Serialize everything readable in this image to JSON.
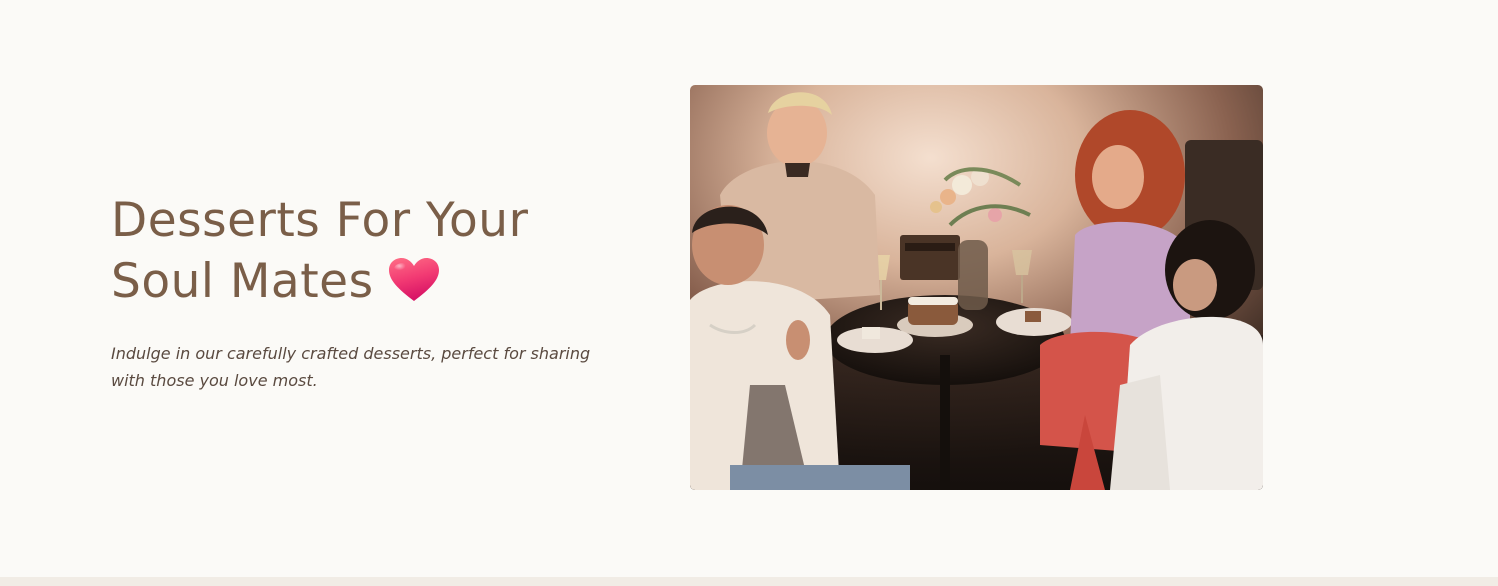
{
  "hero": {
    "headline_line1": "Desserts For Your",
    "headline_line2": "Soul Mates",
    "heart_icon": "red-heart-emoji",
    "tagline": "Indulge in our carefully crafted desserts, perfect for sharing with those you love most."
  },
  "photo": {
    "subject": "friends-sharing-desserts-photo"
  },
  "colors": {
    "background": "#fbfaf7",
    "headline": "#7a5e48",
    "body_text": "#5a4a40",
    "footer_band": "#f1ece5",
    "heart_top": "#ff5a7a",
    "heart_bottom": "#e0186b"
  }
}
